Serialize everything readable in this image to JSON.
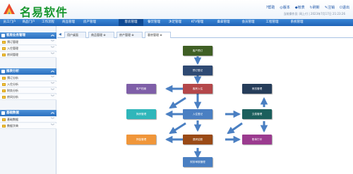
{
  "header": {
    "logo_text": "名易软件",
    "links": [
      "?帮助",
      "◎版本",
      "◆帐表",
      "↻刷新",
      "✎注销",
      "⏻退出"
    ],
    "status": "当前操作员: 网上付 | 2023年7月17日 21:23:26"
  },
  "nav": {
    "items": [
      "员工门户",
      "商品门户",
      "工作流程",
      "商品管理",
      "房产管理",
      "客房管理",
      "餐饮管理",
      "沐足管理",
      "KTV管理",
      "桑拿管理",
      "会员管理",
      "工程管理",
      "系统管理"
    ],
    "active_index": 5
  },
  "sidebar": {
    "sections": [
      {
        "title": "客房业务管理",
        "items": [
          "预订管理",
          "入住管理",
          "房间管理"
        ]
      },
      {
        "title": "报表分析",
        "items": [
          "预订分析",
          "入住分析",
          "财务分析",
          "房间分析"
        ]
      },
      {
        "title": "基础数据",
        "items": [
          "基础数据",
          "数据字典"
        ]
      }
    ]
  },
  "tabs": [
    "用户桌面",
    "商品管理 ⊗",
    "房产管理 ⊗",
    "客房管理 ⊗"
  ],
  "tabs_active_index": 3,
  "diagram": {
    "nodes": {
      "reservation": "客户预订",
      "reservation_form": "预订登记",
      "guest_checkin": "客房入住",
      "guest_info": "客户档案",
      "checkin_reg": "入住登记",
      "room_change": "换房管理",
      "deposit": "押金管理",
      "checkout": "退房结账",
      "bill": "账单打印",
      "housekeeping": "房态管理",
      "consume": "交易管理",
      "finance": "财务审核管理"
    },
    "colors": {
      "olive": "#3f5f24",
      "navy": "#2f4a73",
      "red": "#b4474a",
      "purple": "#7f5fa8",
      "blue": "#4a7fc2",
      "teal": "#2fb6ba",
      "orange": "#f0963a",
      "brown": "#9a4a16",
      "darkslate": "#263d5a",
      "darkteal": "#1b5f5c",
      "magenta": "#9b3b8f",
      "arrow": "#4a7fc2"
    }
  }
}
